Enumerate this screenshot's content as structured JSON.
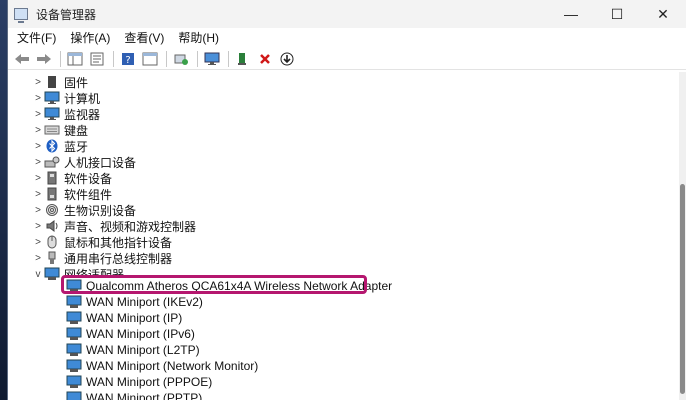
{
  "window": {
    "title": "设备管理器",
    "controls": [
      "—",
      "☐",
      "✕"
    ]
  },
  "menu": [
    "文件(F)",
    "操作(A)",
    "查看(V)",
    "帮助(H)"
  ],
  "colors": {
    "highlight_border": "#b5176f",
    "adapter_icon": "#2f7fd0"
  },
  "tree": {
    "categories": [
      {
        "label": "固件",
        "icon": "firmware-icon"
      },
      {
        "label": "计算机",
        "icon": "computer-icon"
      },
      {
        "label": "监视器",
        "icon": "monitor-icon"
      },
      {
        "label": "键盘",
        "icon": "keyboard-icon"
      },
      {
        "label": "蓝牙",
        "icon": "bluetooth-icon"
      },
      {
        "label": "人机接口设备",
        "icon": "hid-icon"
      },
      {
        "label": "软件设备",
        "icon": "software-device-icon"
      },
      {
        "label": "软件组件",
        "icon": "software-component-icon"
      },
      {
        "label": "生物识别设备",
        "icon": "fingerprint-icon"
      },
      {
        "label": "声音、视频和游戏控制器",
        "icon": "speaker-icon"
      },
      {
        "label": "鼠标和其他指针设备",
        "icon": "mouse-icon"
      },
      {
        "label": "通用串行总线控制器",
        "icon": "usb-icon"
      },
      {
        "label": "网络适配器",
        "icon": "network-adapter-icon"
      }
    ],
    "network_adapters": [
      "Qualcomm Atheros QCA61x4A Wireless Network Adapter",
      "WAN Miniport (IKEv2)",
      "WAN Miniport (IP)",
      "WAN Miniport (IPv6)",
      "WAN Miniport (L2TP)",
      "WAN Miniport (Network Monitor)",
      "WAN Miniport (PPPOE)",
      "WAN Miniport (PPTP)"
    ]
  }
}
